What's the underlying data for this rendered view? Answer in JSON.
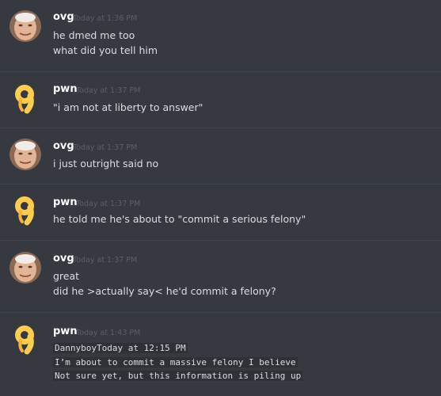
{
  "messages": [
    {
      "author": "ovg",
      "avatar_icon": "face-photo-icon",
      "timestamp": "Today at 1:36 PM",
      "lines": [
        "he dmed me too",
        "what did you tell him"
      ]
    },
    {
      "author": "pwn",
      "avatar_icon": "ok-hand-emoji-icon",
      "timestamp": "Today at 1:37 PM",
      "lines": [
        "\"i am not at liberty to answer\""
      ]
    },
    {
      "author": "ovg",
      "avatar_icon": "face-photo-icon",
      "timestamp": "Today at 1:37 PM",
      "lines": [
        "i just outright said no"
      ]
    },
    {
      "author": "pwn",
      "avatar_icon": "ok-hand-emoji-icon",
      "timestamp": "Today at 1:37 PM",
      "lines": [
        "he told me he's about to \"commit a serious felony\""
      ]
    },
    {
      "author": "ovg",
      "avatar_icon": "face-photo-icon",
      "timestamp": "Today at 1:37 PM",
      "lines": [
        "great",
        "did he >actually say< he'd commit a felony?"
      ]
    },
    {
      "author": "pwn",
      "avatar_icon": "ok-hand-emoji-icon",
      "timestamp": "Today at 1:43 PM",
      "code_lines": [
        "DannyboyToday at 12:15 PM",
        "I’m about to commit a massive felony I believe",
        "Not sure yet, but this information is piling up"
      ]
    }
  ],
  "colors": {
    "background": "#36393f",
    "username": "#ffffff",
    "timestamp": "#5c5f65",
    "text": "#dcddde",
    "code_background": "#2f3136",
    "divider": "#40444b",
    "ok_hand_yellow": "#ffcc4d"
  }
}
